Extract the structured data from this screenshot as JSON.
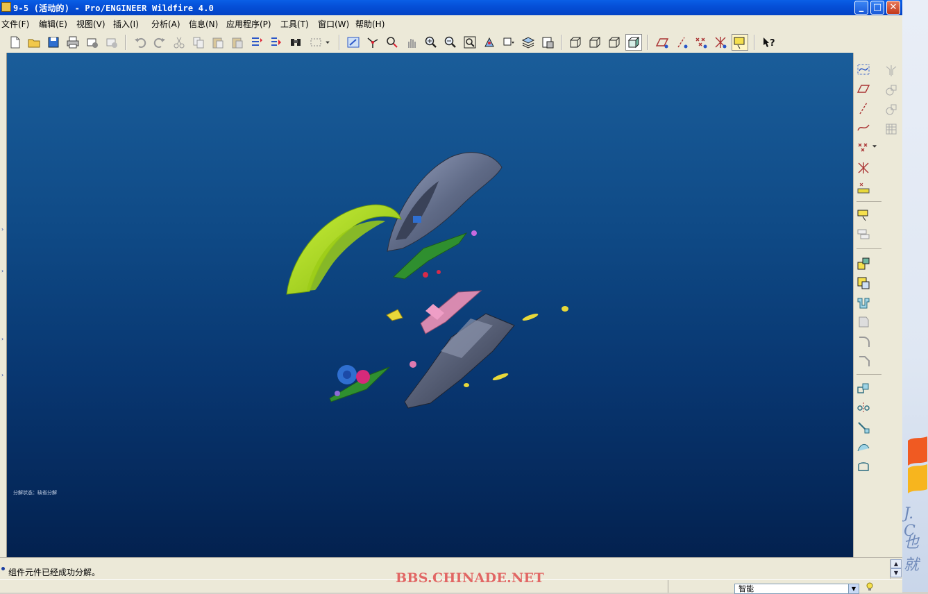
{
  "window": {
    "title": "9-5 (活动的) - Pro/ENGINEER Wildfire 4.0",
    "controls": {
      "minimize": "_",
      "maximize": "□",
      "close": "✕"
    }
  },
  "menu": [
    "文件(F)",
    "编辑(E)",
    "视图(V)",
    "插入(I)",
    "分析(A)",
    "信息(N)",
    "应用程序(P)",
    "工具(T)",
    "窗口(W)",
    "帮助(H)"
  ],
  "toolbar_icons": [
    "new-file-icon",
    "open-folder-icon",
    "save-icon",
    "print-icon",
    "email-icon",
    "email-link-icon",
    "undo-icon",
    "redo-icon",
    "cut-icon",
    "copy-icon",
    "paste-icon",
    "paste-special-icon",
    "regenerate-icon",
    "regen-manager-icon",
    "find-icon",
    "select-box-icon",
    "repaint-icon",
    "spin-center-icon",
    "orient-mode-icon",
    "pan-icon",
    "zoom-in-icon",
    "zoom-out-icon",
    "refit-icon",
    "reorient-icon",
    "saved-views-icon",
    "layers-icon",
    "view-manager-icon",
    "wireframe-icon",
    "hidden-line-icon",
    "no-hidden-icon",
    "shading-icon",
    "datum-planes-icon",
    "datum-axes-icon",
    "datum-points-icon",
    "coordinate-systems-icon",
    "annotations-icon",
    "context-help-icon"
  ],
  "right_toolbar_icons": [
    "sketch-icon",
    "datum-plane-icon",
    "datum-axis-icon",
    "datum-curve-icon",
    "datum-point-icon",
    "coordinate-system-icon",
    "analysis-feature-icon",
    "insert-annotation-icon",
    "insert-note-icon",
    "assemble-component-icon",
    "create-component-icon",
    "cut-out-icon",
    "merge-icon",
    "round-icon",
    "chamfer-icon",
    "offset-icon",
    "mirror-icon",
    "pattern-icon",
    "surface-icon",
    "boundary-icon",
    "mirror-geometry-icon",
    "copy-geometry-icon",
    "publish-geometry-icon",
    "table-icon"
  ],
  "viewport": {
    "hint": "分解状态：缺省分解"
  },
  "status": {
    "message": "组件元件已经成功分解。"
  },
  "selection_filter": {
    "selected": "智能"
  },
  "watermark": "BBS.CHINADE.NET",
  "colors": {
    "titlebar": "#0550d8",
    "viewport_top": "#1a5d9a",
    "viewport_bottom": "#03214f",
    "shell_grey": "#5f6a86",
    "cover_green": "#a7d61a",
    "pcb_green": "#2f8f2f",
    "pink_part": "#d88ab0",
    "yellow_part": "#e8d83a"
  }
}
